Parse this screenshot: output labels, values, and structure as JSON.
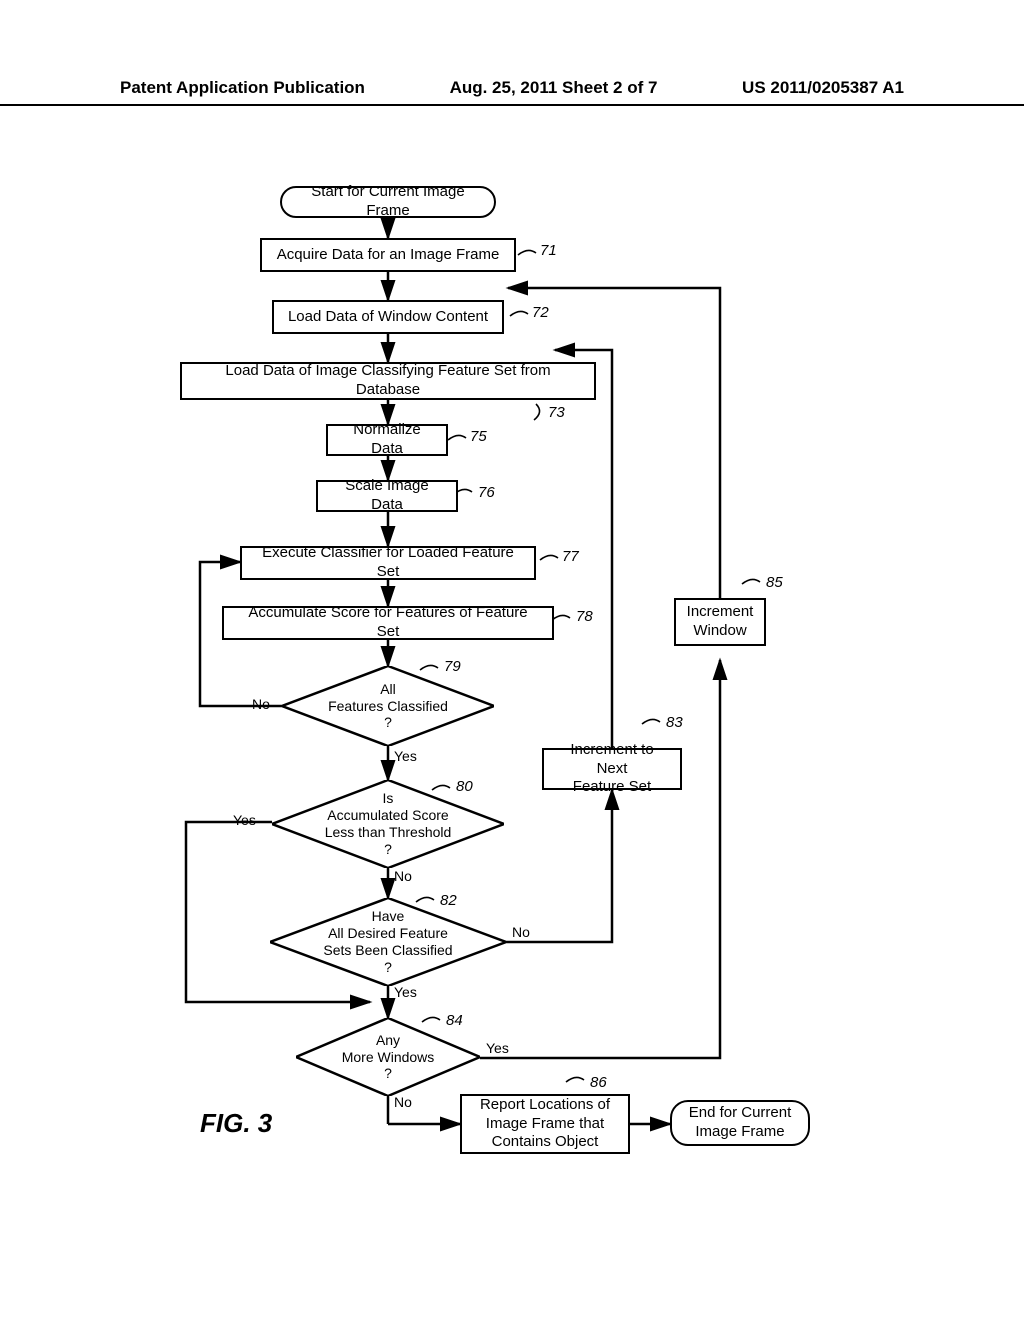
{
  "header": {
    "left": "Patent Application Publication",
    "center": "Aug. 25, 2011  Sheet 2 of 7",
    "right": "US 2011/0205387 A1"
  },
  "figure_label": "FIG. 3",
  "nodes": {
    "start": "Start for Current Image Frame",
    "acquire": "Acquire Data for an Image Frame",
    "loadwin": "Load Data of Window Content",
    "loadfeat": "Load Data of Image Classifying Feature Set from Database",
    "normalize": "Normalize Data",
    "scale": "Scale Image Data",
    "execute": "Execute Classifier for Loaded Feature Set",
    "accumulate": "Accumulate Score for Features of Feature Set",
    "d_all_features": "All\nFeatures Classified\n?",
    "d_threshold": "Is\nAccumulated Score\nLess than Threshold\n?",
    "d_all_sets": "Have\nAll Desired Feature\nSets Been Classified\n?",
    "d_more_windows": "Any\nMore Windows\n?",
    "inc_feature": "Increment to Next\nFeature Set",
    "inc_window": "Increment\nWindow",
    "report": "Report Locations of\nImage Frame that\nContains Object",
    "end": "End for Current\nImage Frame"
  },
  "refs": {
    "acquire": "71",
    "loadwin": "72",
    "loadfeat": "73",
    "normalize": "75",
    "scale": "76",
    "execute": "77",
    "accumulate": "78",
    "d_all_features": "79",
    "d_threshold": "80",
    "d_all_sets": "82",
    "inc_feature": "83",
    "d_more_windows": "84",
    "inc_window": "85",
    "report": "86"
  },
  "labels": {
    "yes": "Yes",
    "no": "No"
  }
}
